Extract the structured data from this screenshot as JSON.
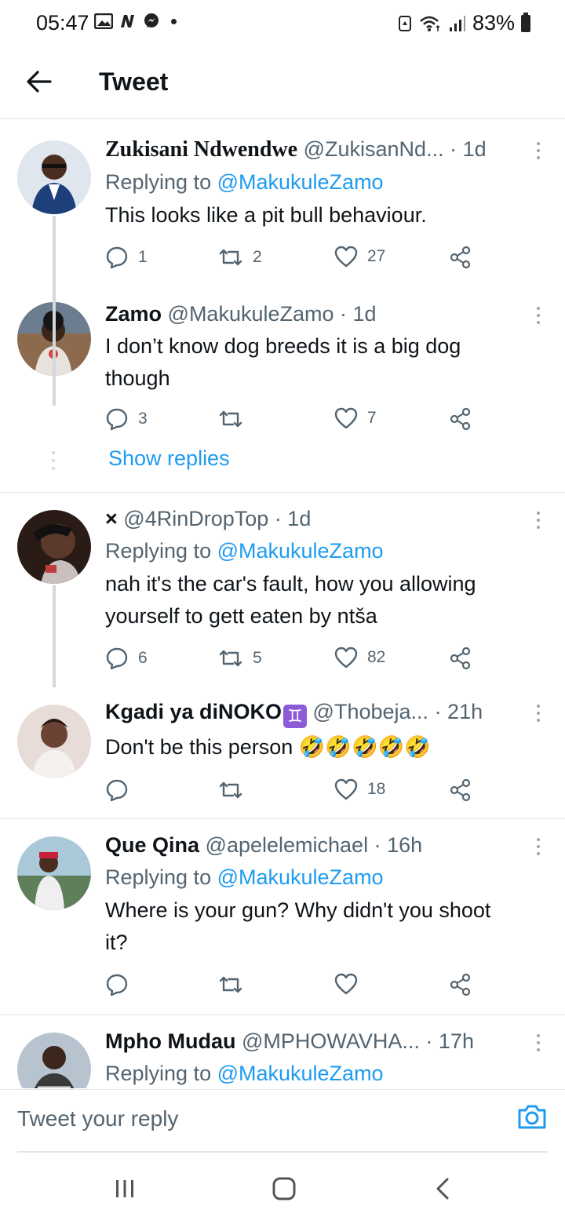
{
  "status_bar": {
    "time": "05:47",
    "battery": "83%"
  },
  "header": {
    "title": "Tweet"
  },
  "colors": {
    "accent": "#1d9bf0",
    "secondary_text": "#536471",
    "primary_text": "#0f1419",
    "divider": "#e1e4e8"
  },
  "tweets": [
    {
      "name": "Zukisani Ndwendwe",
      "handle": "@ZukisanNd...",
      "time": "· 1d",
      "replying_prefix": "Replying to ",
      "replying_to": "@MakukuleZamo",
      "text": "This looks like a pit bull behaviour.",
      "replies": "1",
      "retweets": "2",
      "likes": "27"
    },
    {
      "name": "Zamo",
      "handle": "@MakukuleZamo",
      "time": "· 1d",
      "text_line1": "I don’t know dog breeds it is a big dog",
      "text_line2": "though",
      "replies": "3",
      "retweets": "",
      "likes": "7"
    },
    {
      "name": "×",
      "handle": "@4RinDropTop",
      "time": "· 1d",
      "replying_prefix": "Replying to ",
      "replying_to": "@MakukuleZamo",
      "text_line1": "nah it's the car's fault, how you allowing",
      "text_line2": "yourself to gett eaten by ntša",
      "replies": "6",
      "retweets": "5",
      "likes": "82"
    },
    {
      "name": "Kgadi ya diNOKO",
      "name_badge": "♊",
      "handle": "@Thobeja...",
      "time": "· 21h",
      "text": "Don't be this person",
      "emoji": "🤣🤣🤣🤣🤣",
      "replies": "",
      "retweets": "",
      "likes": "18"
    },
    {
      "name": "Que Qina",
      "handle": "@apelelemichael",
      "time": "· 16h",
      "replying_prefix": "Replying to ",
      "replying_to": "@MakukuleZamo",
      "text_line1": "Where is your gun? Why didn't you shoot",
      "text_line2": "it?",
      "replies": "",
      "retweets": "",
      "likes": ""
    },
    {
      "name": "Mpho Mudau",
      "handle": "@MPHOWAVHA...",
      "time": "· 17h",
      "replying_prefix": "Replying to ",
      "replying_to": "@MakukuleZamo"
    }
  ],
  "show_replies": "Show replies",
  "reply_bar": {
    "placeholder": "Tweet your reply"
  },
  "icons": {
    "back": "arrow-left-icon",
    "reply": "speech-bubble-icon",
    "retweet": "retweet-icon",
    "like": "heart-icon",
    "share": "share-icon",
    "more": "vertical-dots-icon",
    "camera": "camera-icon"
  }
}
